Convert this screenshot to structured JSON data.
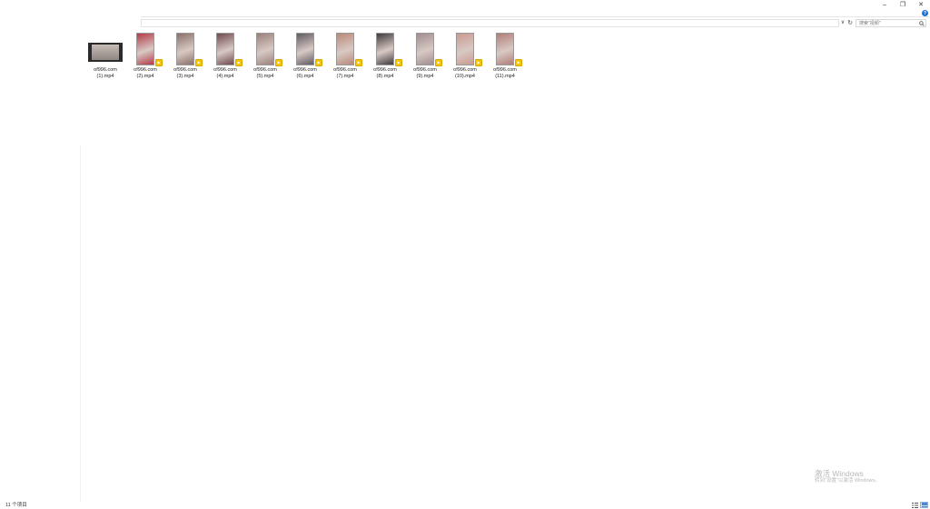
{
  "window": {
    "minimize_glyph": "–",
    "maximize_glyph": "❐",
    "close_glyph": "✕",
    "help_glyph": "?"
  },
  "address_bar": {
    "chevron_glyph": "∨",
    "refresh_glyph": "↻",
    "search_placeholder": "搜索\"视频\""
  },
  "files": [
    {
      "line1": "of996.com",
      "line2": "(1).mp4",
      "kind": "landscape",
      "tint": "#c7bcb6"
    },
    {
      "line1": "of996.com",
      "line2": "(2).mp4",
      "kind": "portrait",
      "tint": "#b23a48"
    },
    {
      "line1": "of996.com",
      "line2": "(3).mp4",
      "kind": "portrait",
      "tint": "#8a6f6a"
    },
    {
      "line1": "of996.com",
      "line2": "(4).mp4",
      "kind": "portrait",
      "tint": "#6e4a4e"
    },
    {
      "line1": "of996.com",
      "line2": "(5).mp4",
      "kind": "portrait",
      "tint": "#9a7f7a"
    },
    {
      "line1": "of996.com",
      "line2": "(6).mp4",
      "kind": "portrait",
      "tint": "#5f5a63"
    },
    {
      "line1": "of996.com",
      "line2": "(7).mp4",
      "kind": "portrait",
      "tint": "#b98a78"
    },
    {
      "line1": "of996.com",
      "line2": "(8).mp4",
      "kind": "portrait",
      "tint": "#3e3a3d"
    },
    {
      "line1": "of996.com",
      "line2": "(9).mp4",
      "kind": "portrait",
      "tint": "#a08c8f"
    },
    {
      "line1": "of996.com",
      "line2": "(10).mp4",
      "kind": "portrait",
      "tint": "#c99a90"
    },
    {
      "line1": "of996.com",
      "line2": "(11).mp4",
      "kind": "portrait",
      "tint": "#b07d78"
    }
  ],
  "watermark": {
    "title": "激活 Windows",
    "subtitle": "转到\"设置\"以激活 Windows。"
  },
  "status": {
    "item_count": "11 个项目"
  },
  "colors": {
    "accent": "#1a73d9",
    "play_badge": "#f5c400"
  }
}
